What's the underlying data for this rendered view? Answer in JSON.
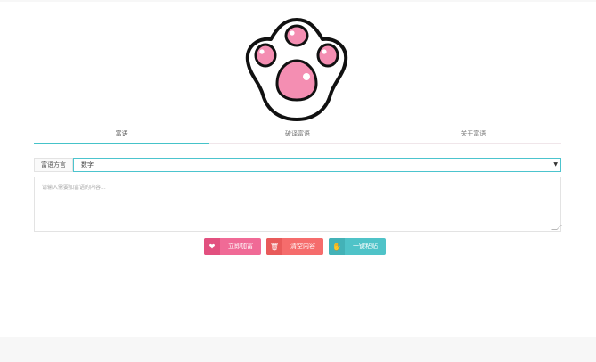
{
  "tabs": [
    {
      "label": "富语"
    },
    {
      "label": "破译富语"
    },
    {
      "label": "关于富语"
    }
  ],
  "dict": {
    "label": "富语方言",
    "selected": "数字"
  },
  "editor": {
    "placeholder": "请输入需要加富语的内容..."
  },
  "buttons": [
    {
      "label": "立即加富",
      "icon": "heart-icon"
    },
    {
      "label": "清空内容",
      "icon": "trash-icon"
    },
    {
      "label": "一键粘贴",
      "icon": "hand-icon"
    }
  ],
  "colors": {
    "accent": "#45c3c9",
    "pink": "#f06a96",
    "red": "#f56c6c",
    "teal": "#4fc3c8"
  }
}
